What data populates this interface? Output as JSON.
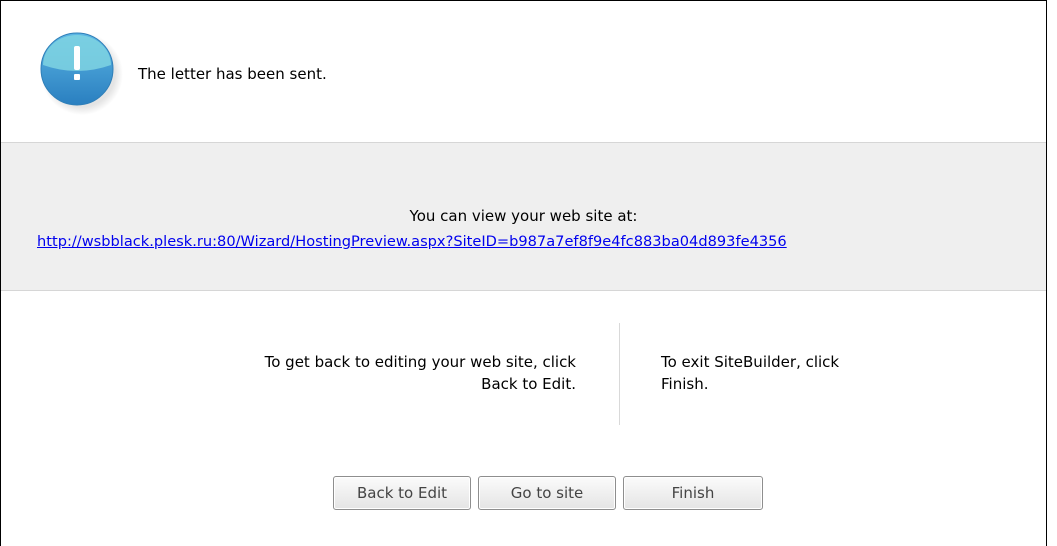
{
  "notice": {
    "icon": "info-exclamation-icon",
    "message": "The letter has been sent.",
    "icon_color": "#3a92c9"
  },
  "preview": {
    "label": "You can view your web site at:",
    "url": "http://wsbblack.plesk.ru:80/Wizard/HostingPreview.aspx?SiteID=b987a7ef8f9e4fc883ba04d893fe4356"
  },
  "instructions": {
    "back_text_line1": "To get back to editing your web site, click",
    "back_text_line2": "Back to Edit.",
    "exit_text_line1": "To exit SiteBuilder, click",
    "exit_text_line2": "Finish."
  },
  "buttons": {
    "back_to_edit": "Back to Edit",
    "go_to_site": "Go to site",
    "finish": "Finish"
  }
}
